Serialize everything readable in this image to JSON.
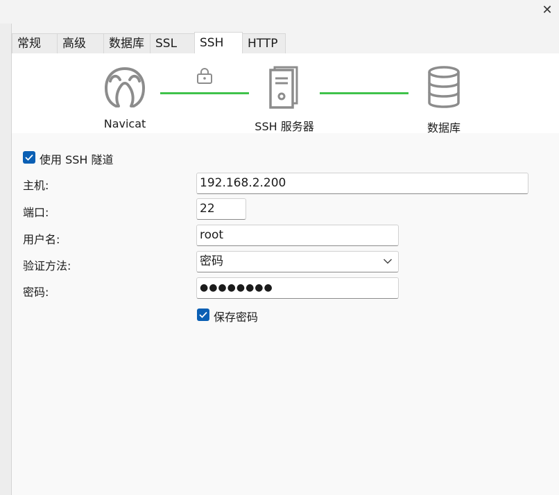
{
  "window": {
    "close_glyph": "✕"
  },
  "tabs": [
    {
      "label": "常规"
    },
    {
      "label": "高级"
    },
    {
      "label": "数据库"
    },
    {
      "label": "SSL"
    },
    {
      "label": "SSH",
      "active": true
    },
    {
      "label": "HTTP"
    }
  ],
  "diagram": {
    "client_label": "Navicat",
    "server_label": "SSH 服务器",
    "database_label": "数据库",
    "line_color": "#3fc24a",
    "icon_color": "#8c8c8c"
  },
  "form": {
    "use_ssh_tunnel": {
      "label": "使用 SSH 隧道",
      "checked": true
    },
    "host": {
      "label": "主机:",
      "value": "192.168.2.200"
    },
    "port": {
      "label": "端口:",
      "value": "22"
    },
    "username": {
      "label": "用户名:",
      "value": "root"
    },
    "auth_method": {
      "label": "验证方法:",
      "value": "密码"
    },
    "password": {
      "label": "密码:",
      "value": "●●●●●●●●"
    },
    "save_password": {
      "label": "保存密码",
      "checked": true
    }
  },
  "colors": {
    "checkbox_accent": "#0a5fb4"
  }
}
